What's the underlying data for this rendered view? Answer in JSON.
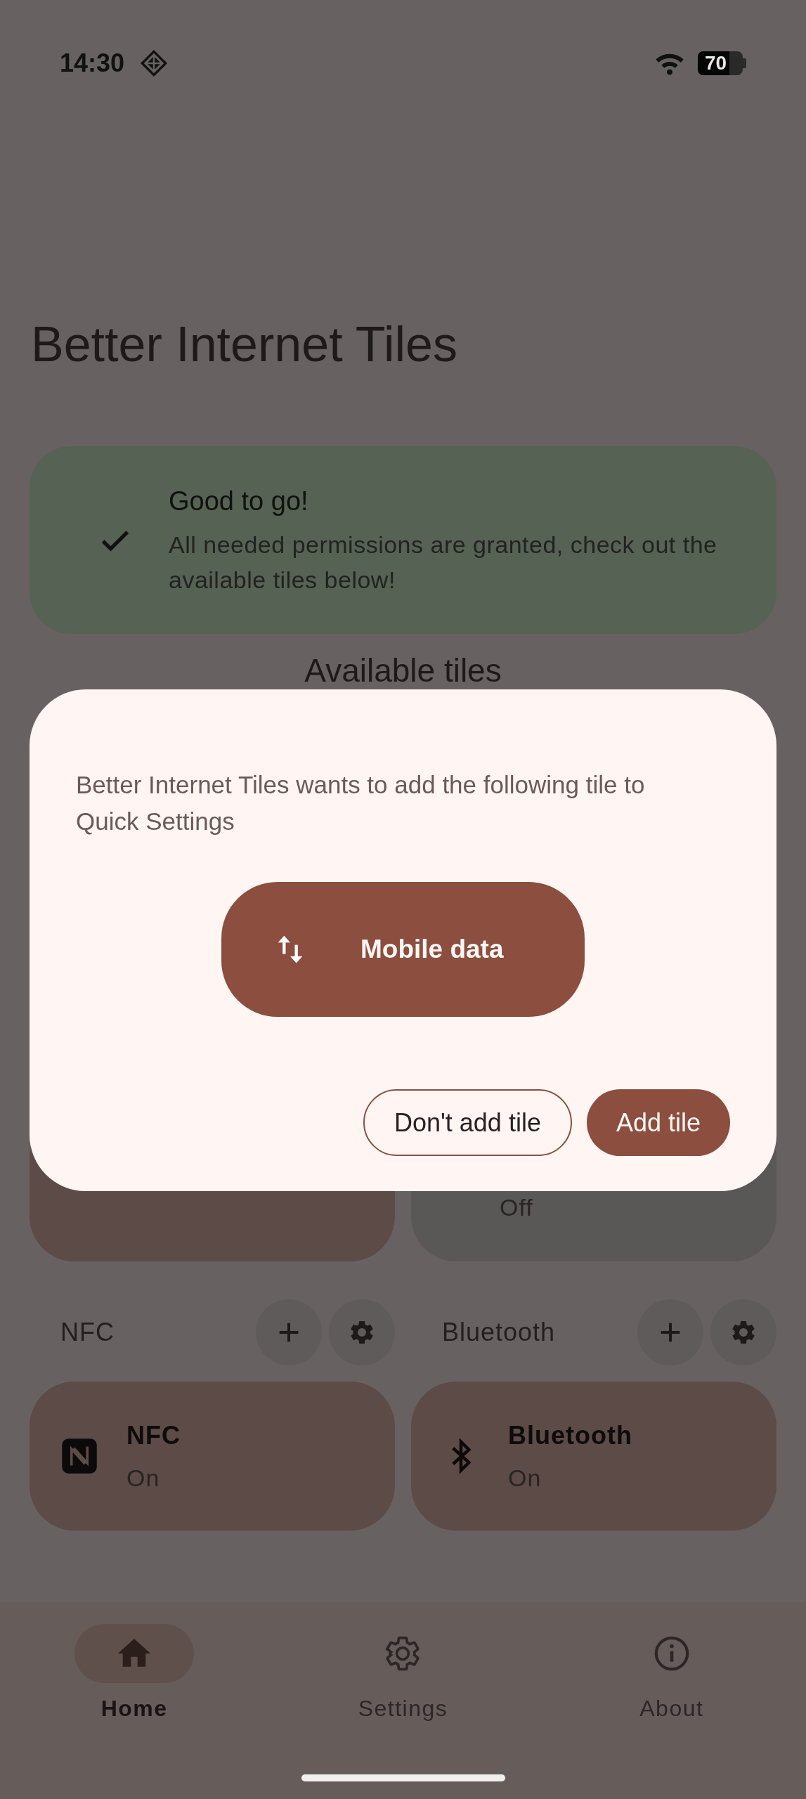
{
  "status_bar": {
    "time": "14:30",
    "battery": "70"
  },
  "title": "Better Internet Tiles",
  "status_card": {
    "title": "Good to go!",
    "text": "All needed permissions are granted, check out the available tiles below!"
  },
  "section_title": "Available tiles",
  "hidden_tiles": [
    {
      "active": true
    },
    {
      "subtitle": "Off",
      "active": false
    }
  ],
  "sections": [
    {
      "label": "NFC",
      "tile": {
        "kind": "nfc",
        "title": "NFC",
        "subtitle": "On",
        "active": true
      }
    },
    {
      "label": "Bluetooth",
      "tile": {
        "kind": "bluetooth",
        "title": "Bluetooth",
        "subtitle": "On",
        "active": true
      }
    }
  ],
  "dialog": {
    "message": "Better Internet Tiles wants to add the following tile to Quick Settings",
    "tile_label": "Mobile data",
    "buttons": [
      {
        "label": "Don't add tile",
        "kind": "outlined"
      },
      {
        "label": "Add tile",
        "kind": "filled"
      }
    ]
  },
  "nav": [
    {
      "label": "Home",
      "kind": "home",
      "selected": true
    },
    {
      "label": "Settings",
      "kind": "settings",
      "selected": false
    },
    {
      "label": "About",
      "kind": "about",
      "selected": false
    }
  ]
}
